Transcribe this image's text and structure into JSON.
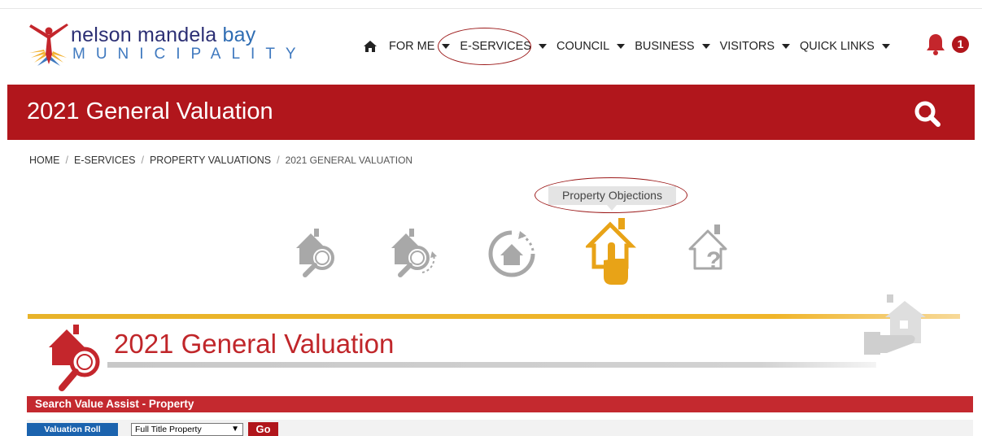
{
  "logo": {
    "name_part1": "nelson mandela",
    "name_part2": "bay",
    "sub": "MUNICIPALITY"
  },
  "nav": {
    "items": [
      {
        "label": "FOR ME"
      },
      {
        "label": "E-SERVICES"
      },
      {
        "label": "COUNCIL"
      },
      {
        "label": "BUSINESS"
      },
      {
        "label": "VISITORS"
      },
      {
        "label": "QUICK LINKS"
      }
    ],
    "notification_count": "1"
  },
  "header": {
    "title": "2021 General Valuation"
  },
  "breadcrumb": {
    "items": [
      "HOME",
      "E-SERVICES",
      "PROPERTY VALUATIONS"
    ],
    "current": "2021 GENERAL VALUATION"
  },
  "tooltip": "Property Objections",
  "icons": [
    {
      "name": "property-search-icon",
      "active": false
    },
    {
      "name": "property-search-refresh-icon",
      "active": false
    },
    {
      "name": "house-cycle-icon",
      "active": false
    },
    {
      "name": "property-objections-icon",
      "active": true
    },
    {
      "name": "house-question-icon",
      "active": false
    }
  ],
  "section": {
    "title": "2021 General Valuation"
  },
  "search_bar": {
    "label": "Search Value Assist - Property"
  },
  "form": {
    "valuation_button": "Valuation Roll",
    "select_value": "Full Title Property",
    "go_button": "Go"
  },
  "colors": {
    "brand_red": "#b1161c",
    "accent_yellow": "#e8b329",
    "icon_grey": "#a8a8a8",
    "active_icon": "#e8a317",
    "link_blue": "#1b63ae"
  }
}
